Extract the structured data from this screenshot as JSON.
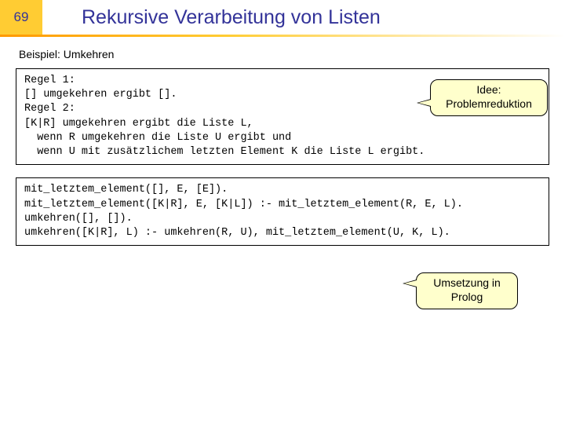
{
  "slide_number": "69",
  "title": "Rekursive Verarbeitung von Listen",
  "subhead": "Beispiel: Umkehren",
  "box1": "Regel 1:\n[] umgekehren ergibt [].\nRegel 2:\n[K|R] umgekehren ergibt die Liste L,\n  wenn R umgekehren die Liste U ergibt und\n  wenn U mit zusätzlichem letzten Element K die Liste L ergibt.",
  "box2": "mit_letztem_element([], E, [E]).\nmit_letztem_element([K|R], E, [K|L]) :- mit_letztem_element(R, E, L).\numkehren([], []).\numkehren([K|R], L) :- umkehren(R, U), mit_letztem_element(U, K, L).",
  "callout1_line1": "Idee:",
  "callout1_line2": "Problemreduktion",
  "callout2_line1": "Umsetzung in",
  "callout2_line2": "Prolog"
}
